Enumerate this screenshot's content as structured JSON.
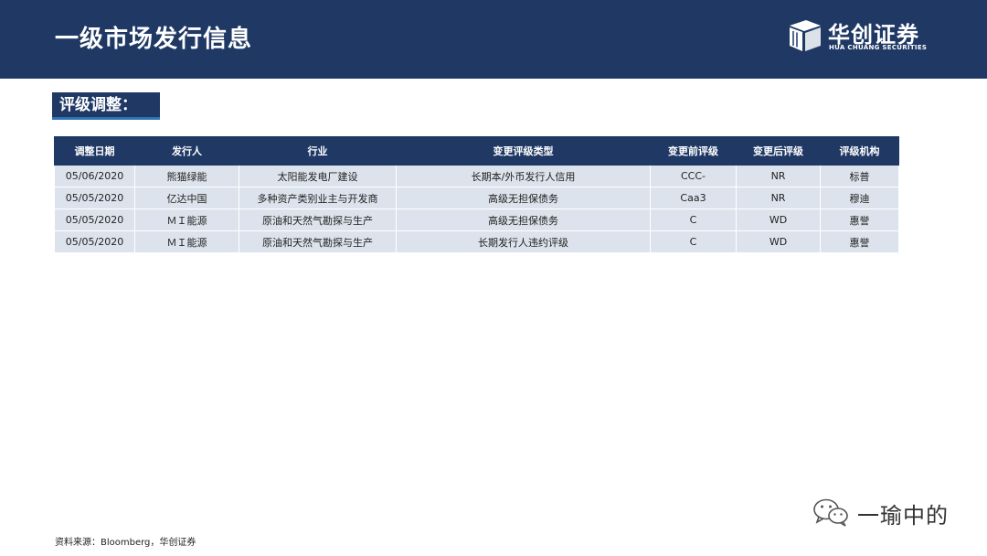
{
  "header": {
    "title": "一级市场发行信息",
    "logo": {
      "name_cn": "华创证券",
      "name_en": "HUA CHUANG SECURITIES"
    }
  },
  "section": {
    "label": "评级调整："
  },
  "table": {
    "headers": [
      "调整日期",
      "发行人",
      "行业",
      "变更评级类型",
      "变更前评级",
      "变更后评级",
      "评级机构"
    ],
    "rows": [
      [
        "05/06/2020",
        "熊猫绿能",
        "太阳能发电厂建设",
        "长期本/外币发行人信用",
        "CCC-",
        "NR",
        "标普"
      ],
      [
        "05/05/2020",
        "亿达中国",
        "多种资产类别业主与开发商",
        "高级无担保债务",
        "Caa3",
        "NR",
        "穆迪"
      ],
      [
        "05/05/2020",
        "ＭＩ能源",
        "原油和天然气勘探与生产",
        "高级无担保债务",
        "C",
        "WD",
        "惠誉"
      ],
      [
        "05/05/2020",
        "ＭＩ能源",
        "原油和天然气勘探与生产",
        "长期发行人违约评级",
        "C",
        "WD",
        "惠誉"
      ]
    ]
  },
  "watermark": {
    "text": "一瑜中的",
    "icon": "wechat-icon"
  },
  "footnote": "资料来源：Bloomberg，华创证券",
  "colors": {
    "header_bg": "#1f3864",
    "row_bg": "#dde3ec",
    "accent": "#2e75b6"
  }
}
